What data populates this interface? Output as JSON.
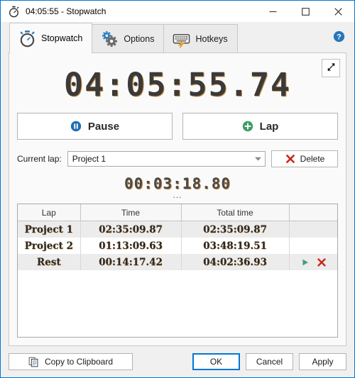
{
  "window": {
    "title": "04:05:55 - Stopwatch",
    "title_icon": "stopwatch-icon",
    "minimize_label": "—",
    "maximize_label": "□",
    "close_label": "✕",
    "accent_color": "#0078d7"
  },
  "tabs": [
    {
      "label": "Stopwatch",
      "icon": "stopwatch-icon",
      "active": true
    },
    {
      "label": "Options",
      "icon": "gears-icon",
      "active": false
    },
    {
      "label": "Hotkeys",
      "icon": "keyboard-lightning-icon",
      "active": false
    }
  ],
  "help": {
    "icon": "help-question-icon"
  },
  "expand": {
    "icon": "expand-diagonal-arrow-icon"
  },
  "display": {
    "main_time": "04:05:55.74",
    "sub_time": "00:03:18.80",
    "ellipsis": "...",
    "digit_color": "#3a3a3a"
  },
  "controls": {
    "pause_label": "Pause",
    "pause_icon": "pause-circle-icon",
    "pause_icon_color": "#1f6fb4",
    "lap_label": "Lap",
    "lap_icon": "plus-circle-icon",
    "lap_icon_color": "#3d9c63"
  },
  "current_lap": {
    "label": "Current lap:",
    "value": "Project 1",
    "dropdown_icon": "chevron-down-icon",
    "delete_label": "Delete",
    "delete_icon": "red-x-icon",
    "delete_icon_color": "#cc2a1e"
  },
  "table": {
    "columns": [
      "Lap",
      "Time",
      "Total time",
      ""
    ],
    "rows": [
      {
        "lap": "Project 1",
        "time": "02:35:09.87",
        "total": "02:35:09.87",
        "actions": false
      },
      {
        "lap": "Project 2",
        "time": "01:13:09.63",
        "total": "03:48:19.51",
        "actions": false
      },
      {
        "lap": "Rest",
        "time": "00:14:17.42",
        "total": "04:02:36.93",
        "actions": true
      }
    ],
    "action_icons": {
      "play": "play-triangle-icon",
      "play_color": "#46a07a",
      "delete": "red-x-icon",
      "delete_color": "#cc2a1e"
    }
  },
  "footer": {
    "copy_label": "Copy to Clipboard",
    "copy_icon": "clipboard-icon",
    "ok_label": "OK",
    "cancel_label": "Cancel",
    "apply_label": "Apply"
  }
}
